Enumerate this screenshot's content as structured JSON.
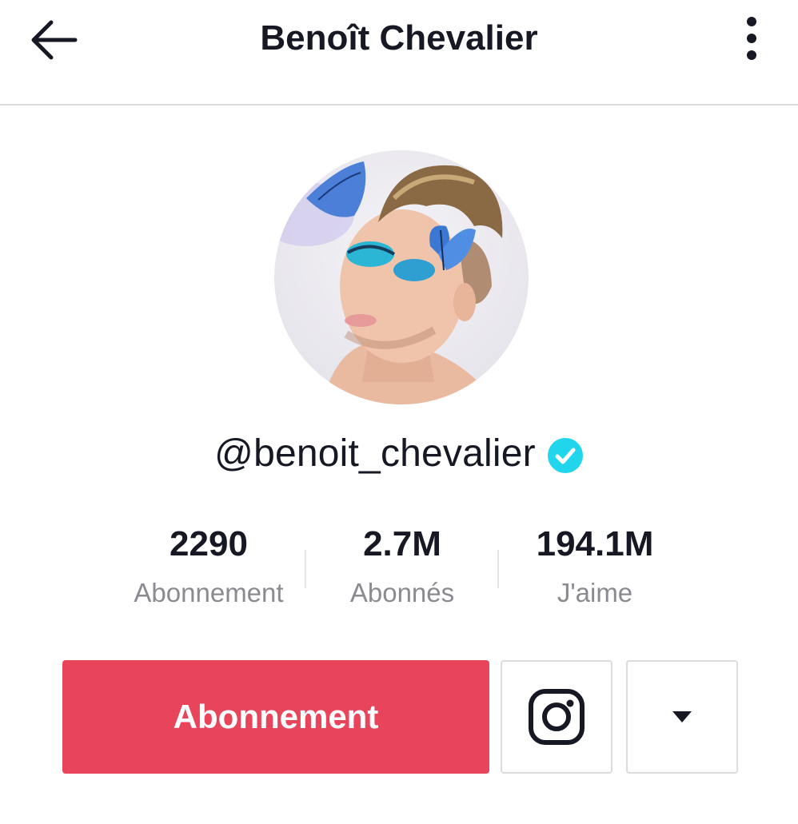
{
  "header": {
    "title": "Benoît Chevalier",
    "back_icon": "arrow-left-icon",
    "more_icon": "vertical-dots-icon"
  },
  "profile": {
    "username": "@benoit_chevalier",
    "verified": true,
    "verified_icon": "verified-check-icon",
    "verified_color": "#20d5ec"
  },
  "stats": [
    {
      "value": "2290",
      "label": "Abonnement"
    },
    {
      "value": "2.7M",
      "label": "Abonnés"
    },
    {
      "value": "194.1M",
      "label": "J'aime"
    }
  ],
  "actions": {
    "follow_label": "Abonnement",
    "follow_color": "#e8455c",
    "instagram_icon": "instagram-icon",
    "dropdown_icon": "caret-down-icon"
  }
}
